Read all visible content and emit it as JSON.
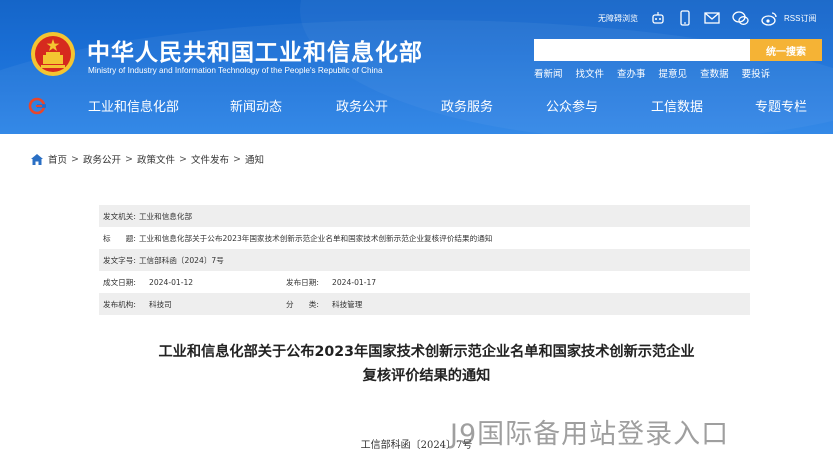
{
  "header": {
    "title": "中华人民共和国工业和信息化部",
    "subtitle": "Ministry of Industry and Information Technology of the People's Republic of China",
    "accessibility": "无障碍浏览",
    "rss": "RSS订阅",
    "search": {
      "placeholder": "",
      "button": "统一搜索"
    },
    "quick_links": [
      "看新闻",
      "找文件",
      "查办事",
      "提意见",
      "查数据",
      "要投诉"
    ]
  },
  "nav": {
    "items": [
      "工业和信息化部",
      "新闻动态",
      "政务公开",
      "政务服务",
      "公众参与",
      "工信数据",
      "专题专栏"
    ]
  },
  "breadcrumb": [
    "首页",
    "政务公开",
    "政策文件",
    "文件发布",
    "通知"
  ],
  "meta": {
    "issuer_label": "发文机关:",
    "issuer": "工业和信息化部",
    "title_label": "标　　题:",
    "title": "工业和信息化部关于公布2023年国家技术创新示范企业名单和国家技术创新示范企业复核评价结果的通知",
    "doc_no_label": "发文字号:",
    "doc_no": "工信部科函〔2024〕7号",
    "created_label": "成文日期:",
    "created": "2024-01-12",
    "published_label": "发布日期:",
    "published": "2024-01-17",
    "org_label": "发布机构:",
    "org": "科技司",
    "category_label": "分　　类:",
    "category": "科技管理"
  },
  "document": {
    "title_line1": "工业和信息化部关于公布2023年国家技术创新示范企业名单和国家技术创新示范企业",
    "title_line2": "复核评价结果的通知",
    "number": "工信部科函〔2024〕7号"
  },
  "watermark": "J9国际备用站登录入口",
  "colors": {
    "header_blue": "#1a6fd6",
    "search_button": "#f5b335",
    "meta_shade": "#eeeeee"
  }
}
